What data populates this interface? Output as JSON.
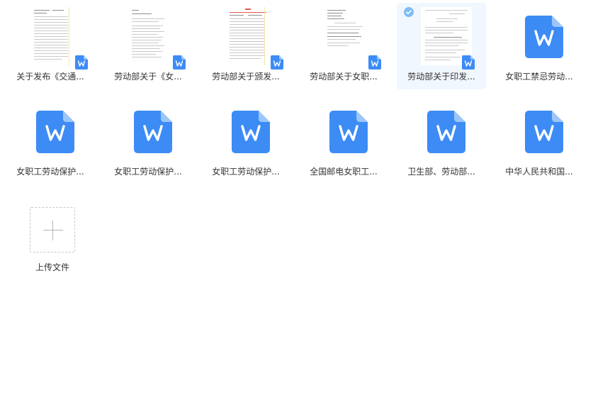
{
  "files": [
    {
      "name": "关于发布《交通...",
      "icon": "word-thumbnail",
      "selected": false
    },
    {
      "name": "劳动部关于《女...",
      "icon": "word-thumbnail",
      "selected": false
    },
    {
      "name": "劳动部关于颁发...",
      "icon": "word-thumbnail",
      "selected": false
    },
    {
      "name": "劳动部关于女职...",
      "icon": "word-thumbnail",
      "selected": false
    },
    {
      "name": "劳动部关于印发...",
      "icon": "word-thumbnail",
      "selected": true
    },
    {
      "name": "女职工禁忌劳动...",
      "icon": "word-icon",
      "selected": false
    },
    {
      "name": "女职工劳动保护...",
      "icon": "word-icon",
      "selected": false
    },
    {
      "name": "女职工劳动保护...",
      "icon": "word-icon",
      "selected": false
    },
    {
      "name": "女职工劳动保护...",
      "icon": "word-icon",
      "selected": false
    },
    {
      "name": "全国邮电女职工...",
      "icon": "word-icon",
      "selected": false
    },
    {
      "name": "卫生部、劳动部...",
      "icon": "word-icon",
      "selected": false
    },
    {
      "name": "中华人民共和国...",
      "icon": "word-icon",
      "selected": false
    }
  ],
  "upload": {
    "label": "上传文件",
    "icon": "plus-icon"
  },
  "colors": {
    "word_blue": "#3d8bf5",
    "selected_bg": "#f1f7fe",
    "check_blue": "#7fbdf7"
  }
}
